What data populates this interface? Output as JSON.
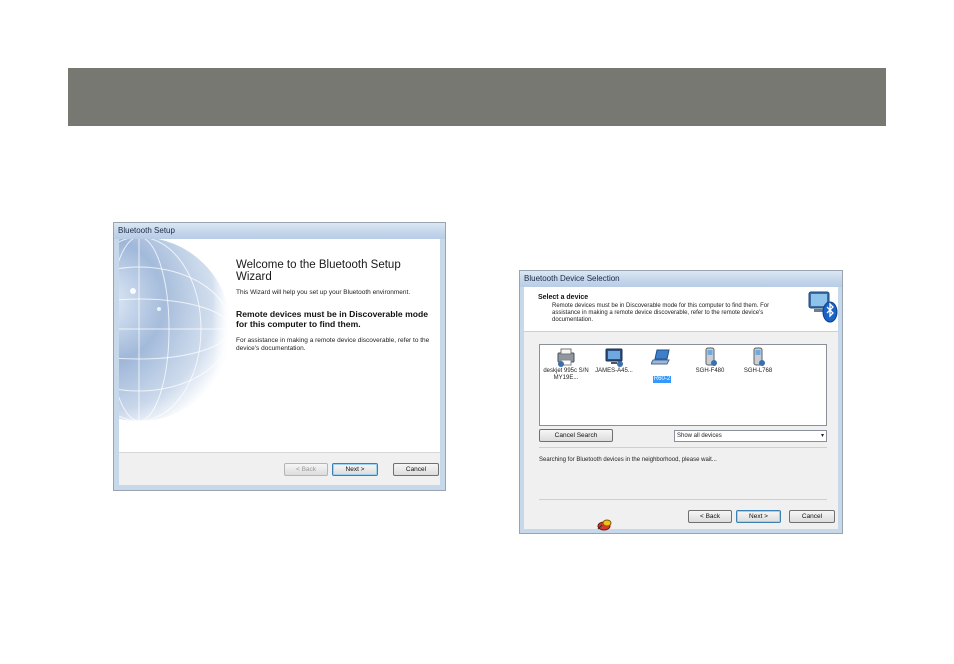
{
  "setup_wizard": {
    "window_title": "Bluetooth Setup",
    "heading": "Welcome to the Bluetooth Setup Wizard",
    "intro": "This Wizard will help you set up your Bluetooth environment.",
    "bold_note": "Remote devices must be in Discoverable mode for this computer to find them.",
    "assist": "For assistance in making a remote device discoverable, refer to the device's documentation.",
    "back_label": "< Back",
    "next_label": "Next >",
    "cancel_label": "Cancel"
  },
  "device_selection": {
    "window_title": "Bluetooth Device Selection",
    "header_title": "Select a device",
    "header_desc": "Remote devices must be in Discoverable mode for this computer to find them. For assistance in making a remote device discoverable, refer to the remote device's documentation.",
    "devices": [
      {
        "label": "deskjet 995c S/N MY19E...",
        "icon": "printer-icon"
      },
      {
        "label": "JAMES-A45...",
        "icon": "computer-icon"
      },
      {
        "label": "R60-2",
        "icon": "laptop-icon",
        "selected": true
      },
      {
        "label": "SGH-F480",
        "icon": "phone-icon"
      },
      {
        "label": "SGH-L768",
        "icon": "phone-icon"
      }
    ],
    "cancel_search_label": "Cancel Search",
    "filter_value": "Show all devices",
    "status_text": "Searching for Bluetooth devices in the neighborhood, please wait...",
    "back_label": "< Back",
    "next_label": "Next >",
    "cancel_label": "Cancel"
  },
  "colors": {
    "banner": "#777871",
    "window_frame": "#c8d8eb",
    "selection": "#3399ff"
  }
}
